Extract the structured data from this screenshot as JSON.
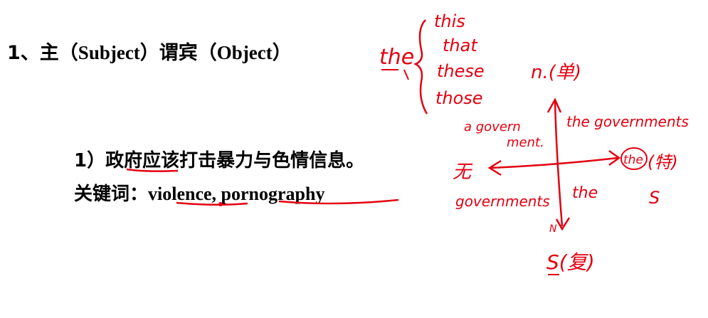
{
  "heading": {
    "number": "1、",
    "cn_subject": "主",
    "paren_open_1": "（",
    "en_subject": "Subject",
    "paren_close_1": "）",
    "cn_object": "谓宾",
    "paren_open_2": "（",
    "en_object": "Object",
    "paren_close_2": "）"
  },
  "exercise": {
    "sentence": "1）政府应该打击暴力与色情信息。",
    "keywords_label": "关键词：",
    "keywords": "violence, pornography"
  },
  "annotations": {
    "determiner": "the",
    "options": [
      "this",
      "that",
      "these",
      "those"
    ],
    "top_label": "n.(单)",
    "bottom_label": "S(复)",
    "left_label": "无",
    "right_label": "(特)",
    "right_article": "the",
    "right_s": "S",
    "quad_top_left": [
      "a govern",
      "ment."
    ],
    "quad_top_right": "the governments",
    "quad_bottom_left": "governments",
    "quad_bottom_right": "the",
    "axis_n": "N"
  },
  "colors": {
    "ink": "#e30010",
    "text": "#000000"
  }
}
